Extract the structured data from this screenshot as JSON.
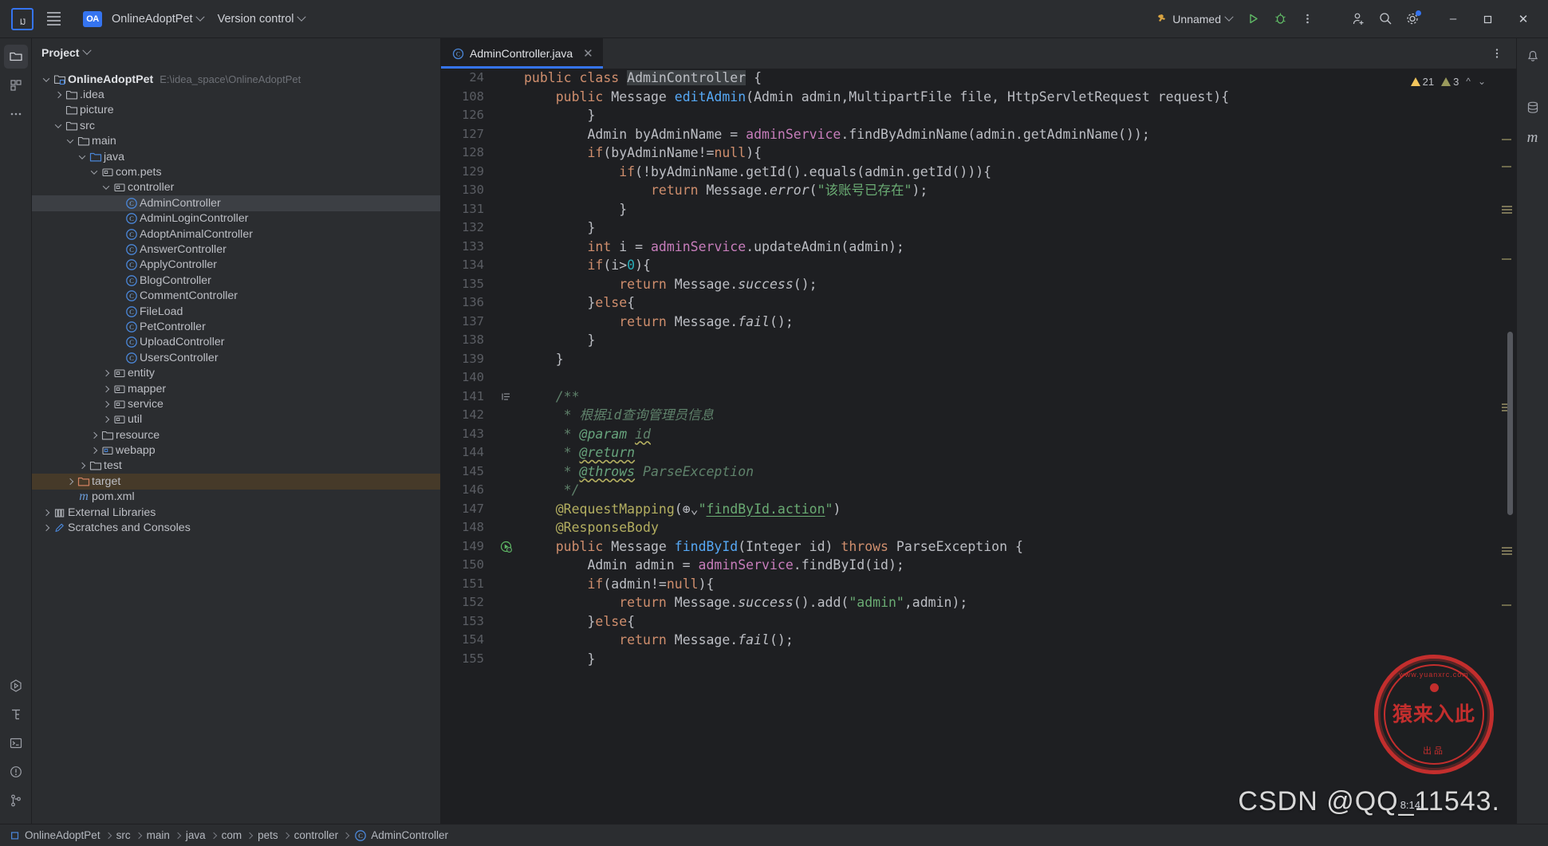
{
  "titlebar": {
    "logo_text": "IJ",
    "menu_icon": "hamburger-menu-icon",
    "project_badge": "OA",
    "project_name": "OnlineAdoptPet",
    "vcs_label": "Version control",
    "run_config": "Unnamed",
    "run_icon": "run-icon",
    "debug_icon": "debug-icon",
    "more_icon": "more-vertical-icon",
    "account_icon": "add-account-icon",
    "search_icon": "search-icon",
    "settings_icon": "gear-icon",
    "minimize": "–",
    "maximize": "❐",
    "close": "✕"
  },
  "left_rail": {
    "items": [
      {
        "name": "project-tool-window",
        "icon": "folder-icon",
        "active": true
      },
      {
        "name": "commit-tool-window",
        "icon": "commit-icon",
        "active": false
      },
      {
        "name": "more-tool-windows",
        "icon": "ellipsis-icon",
        "active": false
      }
    ],
    "bottom_items": [
      {
        "name": "run-tool-window",
        "icon": "run-outline-icon"
      },
      {
        "name": "structure-tool-window",
        "icon": "structure-icon"
      },
      {
        "name": "terminal-tool-window",
        "icon": "terminal-icon"
      },
      {
        "name": "problems-tool-window",
        "icon": "warning-circle-icon"
      },
      {
        "name": "version-control-tool-window",
        "icon": "branch-icon"
      }
    ]
  },
  "right_rail": {
    "items": [
      {
        "name": "notifications",
        "icon": "bell-icon"
      },
      {
        "name": "database-tool-window",
        "icon": "database-icon"
      },
      {
        "name": "maven-tool-window",
        "icon": "maven-m-icon"
      }
    ]
  },
  "project_panel": {
    "title": "Project",
    "tree": [
      {
        "indent": 0,
        "arrow": "down",
        "icon": "module-icon",
        "label": "OnlineAdoptPet",
        "bold": true,
        "path": "E:\\idea_space\\OnlineAdoptPet"
      },
      {
        "indent": 1,
        "arrow": "right",
        "icon": "folder-icon",
        "label": ".idea"
      },
      {
        "indent": 1,
        "arrow": "none",
        "icon": "folder-icon",
        "label": "picture"
      },
      {
        "indent": 1,
        "arrow": "down",
        "icon": "folder-icon",
        "label": "src"
      },
      {
        "indent": 2,
        "arrow": "down",
        "icon": "folder-icon",
        "label": "main"
      },
      {
        "indent": 3,
        "arrow": "down",
        "icon": "source-root-icon",
        "label": "java"
      },
      {
        "indent": 4,
        "arrow": "down",
        "icon": "package-icon",
        "label": "com.pets"
      },
      {
        "indent": 5,
        "arrow": "down",
        "icon": "package-icon",
        "label": "controller"
      },
      {
        "indent": 6,
        "arrow": "none",
        "icon": "java-class-icon",
        "label": "AdminController",
        "selected": true
      },
      {
        "indent": 6,
        "arrow": "none",
        "icon": "java-class-icon",
        "label": "AdminLoginController"
      },
      {
        "indent": 6,
        "arrow": "none",
        "icon": "java-class-icon",
        "label": "AdoptAnimalController"
      },
      {
        "indent": 6,
        "arrow": "none",
        "icon": "java-class-icon",
        "label": "AnswerController"
      },
      {
        "indent": 6,
        "arrow": "none",
        "icon": "java-class-icon",
        "label": "ApplyController"
      },
      {
        "indent": 6,
        "arrow": "none",
        "icon": "java-class-icon",
        "label": "BlogController"
      },
      {
        "indent": 6,
        "arrow": "none",
        "icon": "java-class-icon",
        "label": "CommentController"
      },
      {
        "indent": 6,
        "arrow": "none",
        "icon": "java-class-icon",
        "label": "FileLoad"
      },
      {
        "indent": 6,
        "arrow": "none",
        "icon": "java-class-icon",
        "label": "PetController"
      },
      {
        "indent": 6,
        "arrow": "none",
        "icon": "java-class-icon",
        "label": "UploadController"
      },
      {
        "indent": 6,
        "arrow": "none",
        "icon": "java-class-icon",
        "label": "UsersController"
      },
      {
        "indent": 5,
        "arrow": "right",
        "icon": "package-icon",
        "label": "entity"
      },
      {
        "indent": 5,
        "arrow": "right",
        "icon": "package-icon",
        "label": "mapper"
      },
      {
        "indent": 5,
        "arrow": "right",
        "icon": "package-icon",
        "label": "service"
      },
      {
        "indent": 5,
        "arrow": "right",
        "icon": "package-icon",
        "label": "util"
      },
      {
        "indent": 4,
        "arrow": "right",
        "icon": "folder-icon",
        "label": "resource"
      },
      {
        "indent": 4,
        "arrow": "right",
        "icon": "webapp-icon",
        "label": "webapp"
      },
      {
        "indent": 3,
        "arrow": "right",
        "icon": "folder-icon",
        "label": "test"
      },
      {
        "indent": 2,
        "arrow": "right",
        "icon": "target-folder-icon",
        "label": "target",
        "target": true
      },
      {
        "indent": 2,
        "arrow": "none",
        "icon": "maven-m-icon",
        "label": "pom.xml"
      },
      {
        "indent": 0,
        "arrow": "right",
        "icon": "libraries-icon",
        "label": "External Libraries"
      },
      {
        "indent": 0,
        "arrow": "right",
        "icon": "scratches-icon",
        "label": "Scratches and Consoles"
      }
    ]
  },
  "editor": {
    "tab": {
      "icon": "java-class-icon",
      "label": "AdminController.java",
      "close": "✕"
    },
    "tab_options_icon": "more-vertical-icon",
    "inspections": {
      "warning_count": "21",
      "weak_count": "3",
      "up_icon": "chevron-up-icon",
      "down_icon": "chevron-down-icon"
    },
    "sticky_lines": [
      {
        "num": "24",
        "html": "<span class=\"kw\">public</span> <span class=\"kw\">class</span> <span class=\"hl-ident\">AdminController</span> {"
      },
      {
        "num": "108",
        "html": "    <span class=\"kw\">public</span> Message <span class=\"fn\">editAdmin</span>(Admin admin,MultipartFile file, HttpServletRequest request){"
      }
    ],
    "lines": [
      {
        "num": "126",
        "html": "        }"
      },
      {
        "num": "127",
        "html": "        Admin byAdminName = <span class=\"fld\">adminService</span>.findByAdminName(admin.getAdminName());"
      },
      {
        "num": "128",
        "html": "        <span class=\"kw\">if</span>(byAdminName!=<span class=\"kw\">null</span>){"
      },
      {
        "num": "129",
        "html": "            <span class=\"kw\">if</span>(!byAdminName.getId().equals(admin.getId())){"
      },
      {
        "num": "130",
        "html": "                <span class=\"kw\">return</span> Message.<span class=\"stat\">error</span>(<span class=\"str\">\"该账号已存在\"</span>);"
      },
      {
        "num": "131",
        "html": "            }"
      },
      {
        "num": "132",
        "html": "        }"
      },
      {
        "num": "133",
        "html": "        <span class=\"kw\">int</span> i = <span class=\"fld\">adminService</span>.updateAdmin(admin);"
      },
      {
        "num": "134",
        "html": "        <span class=\"kw\">if</span>(i&gt;<span class=\"num\">0</span>){"
      },
      {
        "num": "135",
        "html": "            <span class=\"kw\">return</span> Message.<span class=\"stat\">success</span>();"
      },
      {
        "num": "136",
        "html": "        }<span class=\"kw\">else</span>{"
      },
      {
        "num": "137",
        "html": "            <span class=\"kw\">return</span> Message.<span class=\"stat\">fail</span>();"
      },
      {
        "num": "138",
        "html": "        }"
      },
      {
        "num": "139",
        "html": "    }"
      },
      {
        "num": "140",
        "html": ""
      },
      {
        "num": "141",
        "html": "    <span class=\"doc\">/**</span>",
        "fold": true
      },
      {
        "num": "142",
        "html": "     <span class=\"doc\">* 根据id查询管理员信息</span>"
      },
      {
        "num": "143",
        "html": "     <span class=\"doc\">* </span><span class=\"doct\">@param</span><span class=\"doc\"> </span><span class=\"doc wavy\">id</span>"
      },
      {
        "num": "144",
        "html": "     <span class=\"doc\">* </span><span class=\"doct wavy\">@return</span>"
      },
      {
        "num": "145",
        "html": "     <span class=\"doc\">* </span><span class=\"doct wavy\">@throws</span><span class=\"doc\"> ParseException</span>"
      },
      {
        "num": "146",
        "html": "     <span class=\"doc\">*/</span>"
      },
      {
        "num": "147",
        "html": "    <span class=\"anno\">@RequestMapping</span>(⊕⌄<span class=\"str\">\"</span><span class=\"str ulink\">findById.action</span><span class=\"str\">\"</span>)"
      },
      {
        "num": "148",
        "html": "    <span class=\"anno\">@ResponseBody</span>"
      },
      {
        "num": "149",
        "html": "    <span class=\"kw\">public</span> Message <span class=\"fn\">findById</span>(Integer id) <span class=\"kw\">throws</span> ParseException {",
        "runmark": true
      },
      {
        "num": "150",
        "html": "        Admin admin = <span class=\"fld\">adminService</span>.findById(id);"
      },
      {
        "num": "151",
        "html": "        <span class=\"kw\">if</span>(admin!=<span class=\"kw\">null</span>){"
      },
      {
        "num": "152",
        "html": "            <span class=\"kw\">return</span> Message.<span class=\"stat\">success</span>().add(<span class=\"str\">\"admin\"</span>,admin);"
      },
      {
        "num": "153",
        "html": "        }<span class=\"kw\">else</span>{"
      },
      {
        "num": "154",
        "html": "            <span class=\"kw\">return</span> Message.<span class=\"stat\">fail</span>();"
      },
      {
        "num": "155",
        "html": "        }"
      }
    ]
  },
  "breadcrumb": {
    "items": [
      {
        "icon": "module-square-icon",
        "label": "OnlineAdoptPet"
      },
      {
        "icon": "none",
        "label": "src"
      },
      {
        "icon": "none",
        "label": "main"
      },
      {
        "icon": "none",
        "label": "java"
      },
      {
        "icon": "none",
        "label": "com"
      },
      {
        "icon": "none",
        "label": "pets"
      },
      {
        "icon": "none",
        "label": "controller"
      },
      {
        "icon": "java-class-icon",
        "label": "AdminController"
      }
    ]
  },
  "watermark": {
    "stamp_top": "www.yuanxrc.com",
    "stamp_main": "猿来入此",
    "stamp_bottom": "出品",
    "csdn": "CSDN @QQ_11543.",
    "clock": "8:14"
  },
  "colors": {
    "accent": "#3574f0",
    "panel": "#2b2d30",
    "editor_bg": "#1e1f22",
    "target_highlight": "#463a29",
    "stamp_red": "#d2302f"
  }
}
